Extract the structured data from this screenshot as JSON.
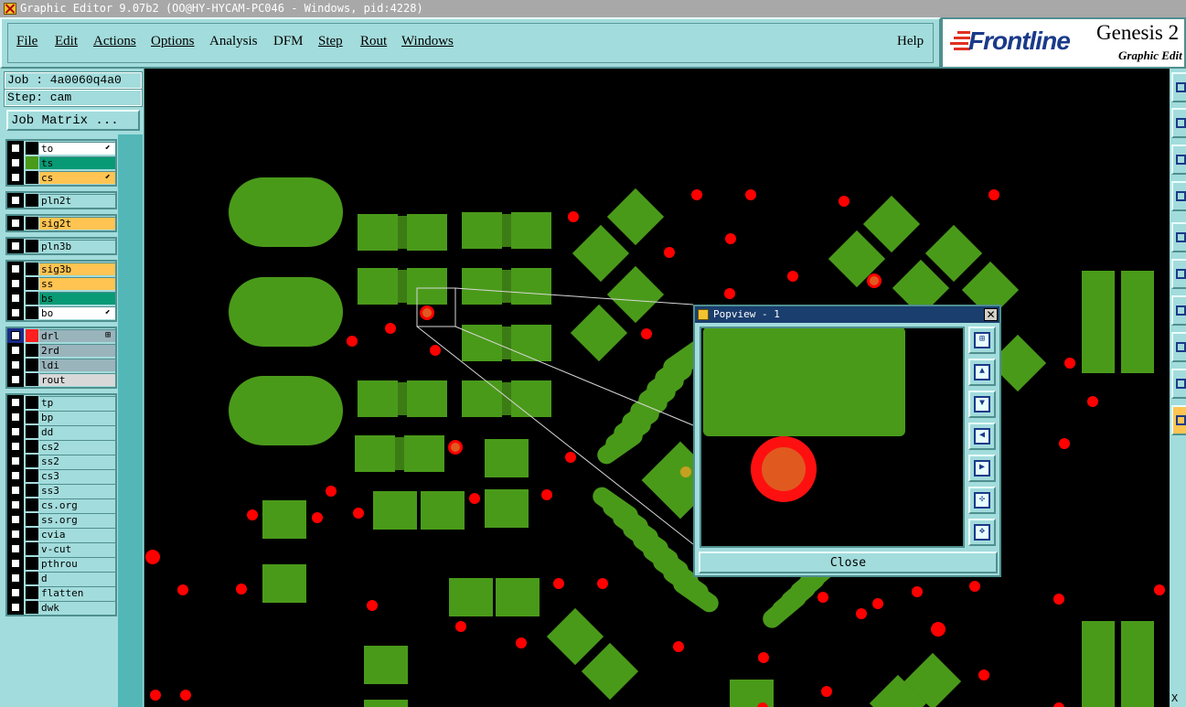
{
  "window": {
    "title": "Graphic Editor 9.07b2 (OO@HY-HYCAM-PC046 - Windows, pid:4228)"
  },
  "menubar": {
    "items": [
      {
        "label": "File"
      },
      {
        "label": "Edit"
      },
      {
        "label": "Actions"
      },
      {
        "label": "Options"
      },
      {
        "label": "Analysis"
      },
      {
        "label": "DFM"
      },
      {
        "label": "Step"
      },
      {
        "label": "Rout"
      },
      {
        "label": "Windows"
      }
    ],
    "help": "Help"
  },
  "brand": {
    "logo": "Frontline",
    "product": "Genesis 2",
    "subtitle": "Graphic Edit",
    "logo_color": "#1a3a8a",
    "accent_color": "#e03020"
  },
  "job": {
    "job_label": "Job : 4a0060q4a0",
    "step_label": "Step: cam",
    "matrix_button": "Job Matrix ..."
  },
  "layer_groups": [
    [
      {
        "name": "to",
        "color": "#ffffff",
        "mark": "⬋",
        "swatch": ""
      },
      {
        "name": "ts",
        "color": "#089a74",
        "mark": "",
        "swatch": "#4a9a1a"
      },
      {
        "name": "cs",
        "color": "#ffc452",
        "mark": "⬋",
        "swatch": ""
      }
    ],
    [
      {
        "name": "pln2t",
        "color": "#a3dcdc",
        "mark": "",
        "swatch": ""
      }
    ],
    [
      {
        "name": "sig2t",
        "color": "#ffc452",
        "mark": "",
        "swatch": ""
      }
    ],
    [
      {
        "name": "pln3b",
        "color": "#a3dcdc",
        "mark": "",
        "swatch": ""
      }
    ],
    [
      {
        "name": "sig3b",
        "color": "#ffc452",
        "mark": "",
        "swatch": ""
      },
      {
        "name": "ss",
        "color": "#ffc452",
        "mark": "",
        "swatch": ""
      },
      {
        "name": "bs",
        "color": "#089a74",
        "mark": "",
        "swatch": ""
      },
      {
        "name": "bo",
        "color": "#ffffff",
        "mark": "⬋",
        "swatch": ""
      }
    ],
    [
      {
        "name": "drl",
        "color": "#9ab4bc",
        "mark": "⊞",
        "swatch": "#ff2020",
        "selected": true
      },
      {
        "name": "2rd",
        "color": "#9ab4bc",
        "mark": "",
        "swatch": ""
      },
      {
        "name": "ldi",
        "color": "#9ab4bc",
        "mark": "",
        "swatch": ""
      },
      {
        "name": "rout",
        "color": "#d8d8d8",
        "mark": "",
        "swatch": ""
      }
    ],
    [
      {
        "name": "tp",
        "color": "#a3dcdc",
        "mark": "",
        "swatch": ""
      },
      {
        "name": "bp",
        "color": "#a3dcdc",
        "mark": "",
        "swatch": ""
      },
      {
        "name": "dd",
        "color": "#a3dcdc",
        "mark": "",
        "swatch": ""
      },
      {
        "name": "cs2",
        "color": "#a3dcdc",
        "mark": "",
        "swatch": ""
      },
      {
        "name": "ss2",
        "color": "#a3dcdc",
        "mark": "",
        "swatch": ""
      },
      {
        "name": "cs3",
        "color": "#a3dcdc",
        "mark": "",
        "swatch": ""
      },
      {
        "name": "ss3",
        "color": "#a3dcdc",
        "mark": "",
        "swatch": ""
      },
      {
        "name": "cs.org",
        "color": "#a3dcdc",
        "mark": "",
        "swatch": ""
      },
      {
        "name": "ss.org",
        "color": "#a3dcdc",
        "mark": "",
        "swatch": ""
      },
      {
        "name": "cvia",
        "color": "#a3dcdc",
        "mark": "",
        "swatch": ""
      },
      {
        "name": "v-cut",
        "color": "#a3dcdc",
        "mark": "",
        "swatch": ""
      },
      {
        "name": "pthrou",
        "color": "#a3dcdc",
        "mark": "",
        "swatch": ""
      },
      {
        "name": "d",
        "color": "#a3dcdc",
        "mark": "",
        "swatch": ""
      },
      {
        "name": "flatten",
        "color": "#a3dcdc",
        "mark": "",
        "swatch": ""
      },
      {
        "name": "dwk",
        "color": "#a3dcdc",
        "mark": "",
        "swatch": ""
      }
    ]
  ],
  "popview": {
    "title": "Popview - 1",
    "close_x": "✕",
    "close_button": "Close",
    "tools": [
      "zoom-window-icon",
      "pan-up-icon",
      "pan-down-icon",
      "pan-left-icon",
      "pan-right-icon",
      "zoom-fit-icon",
      "zoom-center-icon"
    ]
  },
  "right_toolbar": {
    "bottom_label": "X"
  },
  "colors": {
    "panel": "#a3dcdc",
    "pad_green": "#4a9a1a",
    "drill_red": "#ff0000",
    "highlight_orange": "#e05a20"
  }
}
